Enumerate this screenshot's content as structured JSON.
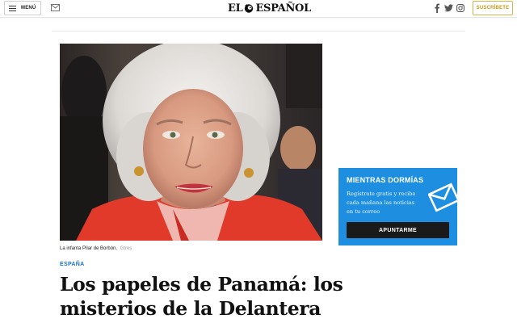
{
  "header": {
    "menu_label": "MENÚ",
    "logo_left": "EL",
    "logo_right": "ESPAÑOL",
    "subscribe_label": "SUSCRÍBETE",
    "icons": [
      "hamburger-icon",
      "mail-icon",
      "lion-logo-icon",
      "facebook-icon",
      "twitter-icon",
      "instagram-icon"
    ]
  },
  "article": {
    "image_caption": "La infanta Pilar de Borbón.",
    "image_credit": "Gtres",
    "section": "ESPAÑA",
    "headline_lines": [
      "Los papeles de Panamá: los",
      "misterios de la Delantera"
    ]
  },
  "newsletter": {
    "title": "MIENTRAS DORMÍAS",
    "text": "Regístrate gratis y recibe cada mañana las noticias en tu correo",
    "button_label": "APUNTARME",
    "icon": "envelope-icon"
  },
  "colors": {
    "accent_blue": "#1e8fe0",
    "section_blue": "#1a73c9",
    "subscribe_gold": "#c79a14",
    "button_dark": "#1a1a1a"
  }
}
